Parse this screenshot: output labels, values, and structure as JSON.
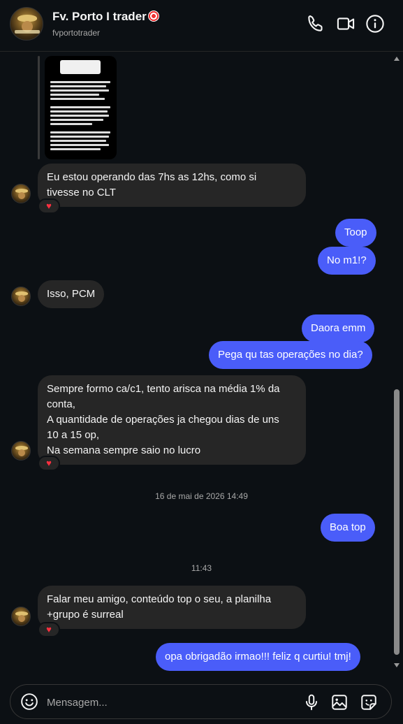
{
  "header": {
    "title": "Fv. Porto I trader",
    "username": "fvportotrader"
  },
  "messages": {
    "m1": "Eu estou operando das 7hs as 12hs, como si",
    "m1b": "tivesse no CLT",
    "m2": "Toop",
    "m3": "No m1!?",
    "m4": "Isso, PCM",
    "m5": "Daora emm",
    "m6": "Pega qu tas operações no dia?",
    "m7a": "Sempre formo ca/c1, tento arisca na média 1% da",
    "m7b": "conta,",
    "m7c": "A quantidade de operações ja chegou dias de uns",
    "m7d": "10 a 15 op,",
    "m7e": "Na semana sempre saio no lucro",
    "m8": "Boa top",
    "m9a": "Falar meu amigo, conteúdo top o seu, a planilha",
    "m9b": "+grupo é surreal",
    "m10": "opa obrigadão irmao!!! feliz q curtiu! tmj!"
  },
  "reaction_emoji": "♥",
  "timestamps": {
    "t1": "16 de mai de 2026 14:49",
    "t2": "11:43"
  },
  "composer": {
    "placeholder": "Mensagem..."
  }
}
